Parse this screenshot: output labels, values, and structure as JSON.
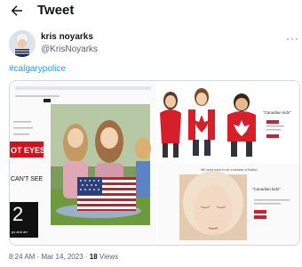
{
  "header": {
    "title": "Tweet"
  },
  "author": {
    "name": "kris noyarks",
    "handle": "@KrisNoyarks"
  },
  "tweet": {
    "hashtag": "#calgarypolice"
  },
  "media": {
    "panel1": {
      "banner_text": "OT EYES",
      "side_text": "CAN'T SEE",
      "number": "2",
      "bottom_text": "ps and art"
    },
    "panel2": {
      "caption": "\"Canadian kids\""
    },
    "panel3": {
      "caption_top": "We need more in our a website of Bullish",
      "caption": "\"Canadian kids\""
    }
  },
  "footer": {
    "time": "8:24 AM",
    "sep1": "·",
    "date": "Mar 14, 2023",
    "sep2": "·",
    "views_count": "18",
    "views_label": "Views"
  },
  "colors": {
    "accent": "#1d9bf0",
    "red_banner": "#d0141e"
  }
}
